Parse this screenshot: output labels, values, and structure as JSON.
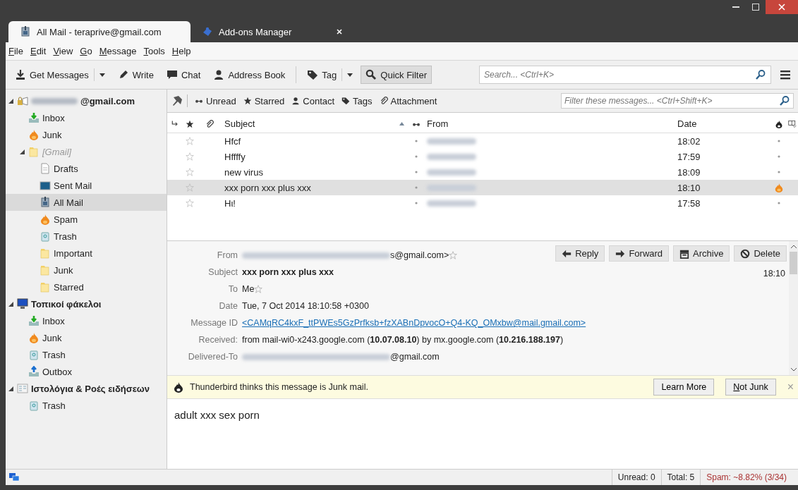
{
  "tabs": [
    {
      "label": "All Mail - teraprive@gmail.com",
      "selected": true,
      "closable": false
    },
    {
      "label": "Add-ons Manager",
      "selected": false,
      "closable": true
    }
  ],
  "menu": [
    "File",
    "Edit",
    "View",
    "Go",
    "Message",
    "Tools",
    "Help"
  ],
  "toolbar": [
    {
      "label": "Get Messages",
      "dropdown": true,
      "on": false
    },
    {
      "label": "Write",
      "dropdown": false,
      "on": false
    },
    {
      "label": "Chat",
      "dropdown": false,
      "on": false
    },
    {
      "label": "Address Book",
      "dropdown": false,
      "on": false,
      "separator_after": true
    },
    {
      "label": "Tag",
      "dropdown": true,
      "on": false
    },
    {
      "label": "Quick Filter",
      "dropdown": false,
      "on": true
    }
  ],
  "search": {
    "placeholder": "Search... <Ctrl+K>"
  },
  "sidebar": {
    "items": [
      {
        "label": "@gmail.com",
        "kind": "account",
        "bold": true,
        "name_hidden": true,
        "expanded": true,
        "selected": false,
        "children": [
          {
            "label": "Inbox",
            "kind": "inbox",
            "selected": false
          },
          {
            "label": "Junk",
            "kind": "junk",
            "selected": false
          },
          {
            "label": "[Gmail]",
            "kind": "folder",
            "dimmed": true,
            "expanded": true,
            "selected": false,
            "children": [
              {
                "label": "Drafts",
                "kind": "drafts",
                "selected": false
              },
              {
                "label": "Sent Mail",
                "kind": "sent",
                "selected": false
              },
              {
                "label": "All Mail",
                "kind": "archive",
                "selected": true
              },
              {
                "label": "Spam",
                "kind": "junk",
                "selected": false
              },
              {
                "label": "Trash",
                "kind": "trash",
                "selected": false
              },
              {
                "label": "Important",
                "kind": "folder",
                "selected": false
              },
              {
                "label": "Junk",
                "kind": "folder",
                "selected": false
              },
              {
                "label": "Starred",
                "kind": "folder",
                "selected": false
              }
            ]
          }
        ]
      },
      {
        "label": "Τοπικοί φάκελοι",
        "kind": "local",
        "bold": true,
        "expanded": true,
        "selected": false,
        "children": [
          {
            "label": "Inbox",
            "kind": "inbox",
            "selected": false
          },
          {
            "label": "Junk",
            "kind": "junk",
            "selected": false
          },
          {
            "label": "Trash",
            "kind": "trash",
            "selected": false
          },
          {
            "label": "Outbox",
            "kind": "outbox",
            "selected": false
          }
        ]
      },
      {
        "label": "Ιστολόγια & Ροές ειδήσεων",
        "kind": "feeds",
        "bold": true,
        "expanded": true,
        "selected": false,
        "children": [
          {
            "label": "Trash",
            "kind": "trash",
            "selected": false
          }
        ]
      }
    ]
  },
  "quick_filter": {
    "items": [
      "Unread",
      "Starred",
      "Contact",
      "Tags",
      "Attachment"
    ],
    "placeholder": "Filter these messages... <Ctrl+Shift+K>"
  },
  "table": {
    "columns": [
      {
        "label": "Subject",
        "sorted": true
      },
      {
        "label": "From",
        "sorted": false
      },
      {
        "label": "Date",
        "sorted": false
      }
    ],
    "rows": [
      {
        "subject": "Hfcf",
        "sender_hidden": true,
        "date": "18:02",
        "starred": false,
        "read": true,
        "junk": false,
        "selected": false
      },
      {
        "subject": "Hffffy",
        "sender_hidden": true,
        "date": "17:59",
        "starred": false,
        "read": true,
        "junk": false,
        "selected": false
      },
      {
        "subject": "new virus",
        "sender_hidden": true,
        "date": "18:09",
        "starred": false,
        "read": true,
        "junk": false,
        "selected": false
      },
      {
        "subject": "xxx porn xxx plus xxx",
        "sender_hidden": true,
        "date": "18:10",
        "starred": false,
        "read": true,
        "junk": true,
        "selected": true
      },
      {
        "subject": "Hι!",
        "sender_hidden": true,
        "date": "17:58",
        "starred": false,
        "read": true,
        "junk": false,
        "selected": false
      }
    ]
  },
  "message": {
    "buttons": [
      "Reply",
      "Forward",
      "Archive",
      "Delete"
    ],
    "time": "18:10",
    "fields": [
      {
        "label": "From",
        "value": "s@gmail.com>",
        "hidden_prefix": true,
        "kind": "address"
      },
      {
        "label": "Subject",
        "value": "xxx porn xxx plus xxx",
        "kind": "bold"
      },
      {
        "label": "To",
        "value": "Me",
        "kind": "address"
      },
      {
        "label": "Date",
        "value": "Tue, 7 Oct 2014 18:10:58 +0300",
        "kind": "plain"
      },
      {
        "label": "Message ID",
        "value": "<CAMqRC4kxF_ttPWEs5GzPrfksb+fzXABnDpvocO+Q4-KQ_OMxbw@mail.gmail.com>",
        "kind": "link"
      },
      {
        "label": "Received:",
        "value": "from mail-wi0-x243.google.com (**10.07.08.10**) by mx.google.com (**10.216.188.197**)",
        "kind": "rich"
      },
      {
        "label": "Delivered-To",
        "value": "@gmail.com",
        "hidden_prefix": true,
        "kind": "plain"
      }
    ],
    "junk_bar": {
      "text": "Thunderbird thinks this message is Junk mail.",
      "buttons": [
        "Learn More",
        "Not Junk"
      ],
      "close": "×"
    },
    "body": "adult xxx sex porn"
  },
  "status_bar": {
    "items": [
      {
        "text": "Unread: 0",
        "alert": false
      },
      {
        "text": "Total: 5",
        "alert": false
      },
      {
        "text": "Spam: ~8.82% (3/34)",
        "alert": true
      }
    ]
  }
}
